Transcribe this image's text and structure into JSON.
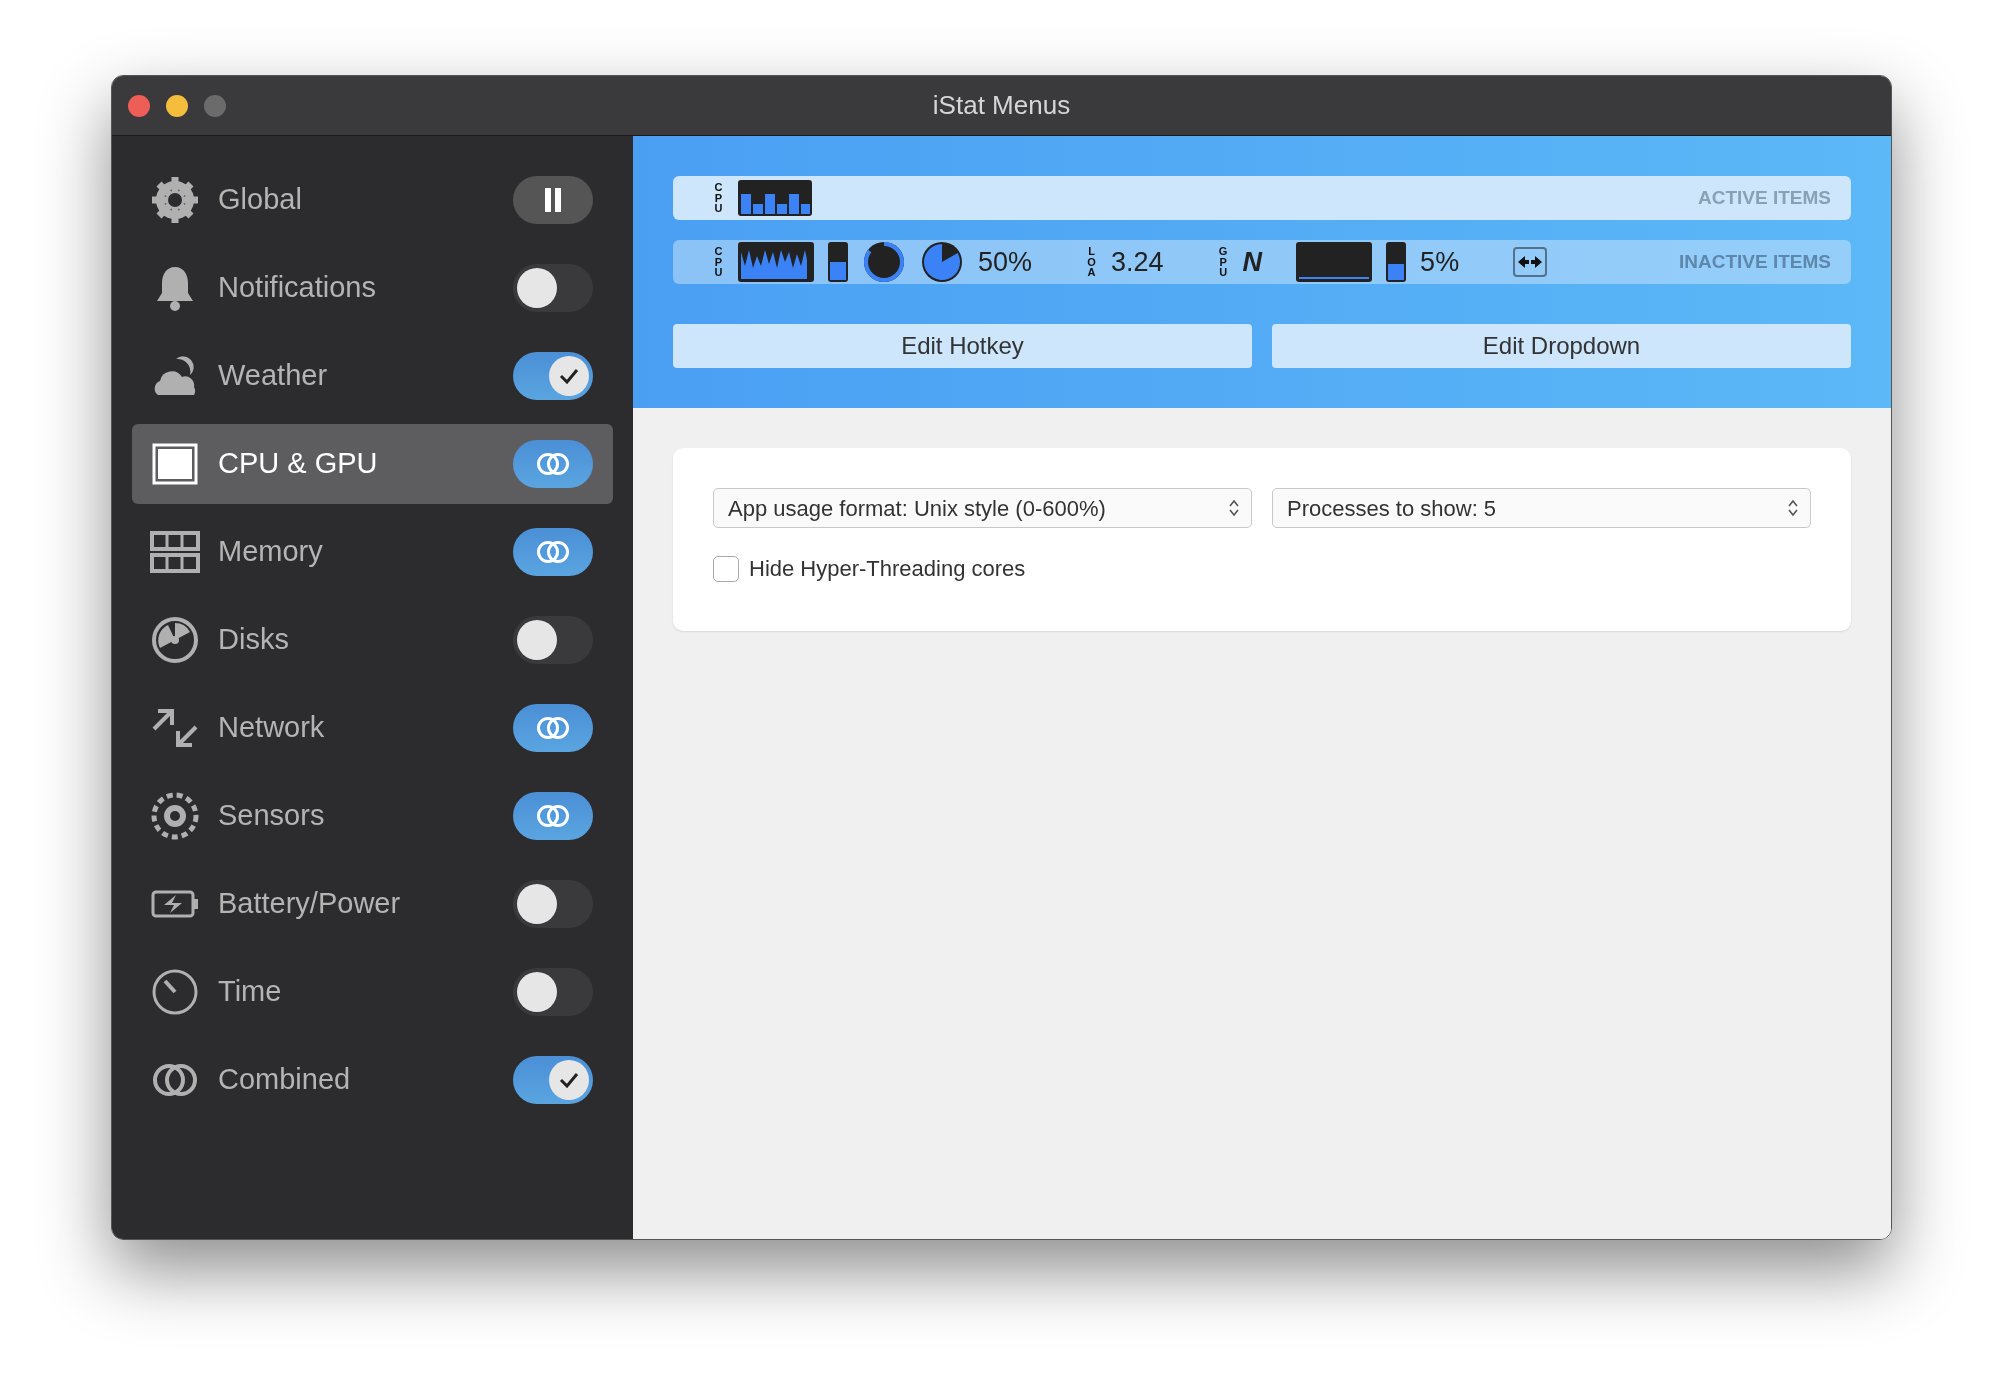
{
  "window": {
    "title": "iStat Menus"
  },
  "sidebar": {
    "items": [
      {
        "label": "Global",
        "selected": false,
        "kind": "pause"
      },
      {
        "label": "Notifications",
        "selected": false,
        "kind": "switch",
        "on": false
      },
      {
        "label": "Weather",
        "selected": false,
        "kind": "switch",
        "on": true
      },
      {
        "label": "CPU & GPU",
        "selected": true,
        "kind": "combined"
      },
      {
        "label": "Memory",
        "selected": false,
        "kind": "combined"
      },
      {
        "label": "Disks",
        "selected": false,
        "kind": "switch",
        "on": false
      },
      {
        "label": "Network",
        "selected": false,
        "kind": "combined"
      },
      {
        "label": "Sensors",
        "selected": false,
        "kind": "combined"
      },
      {
        "label": "Battery/Power",
        "selected": false,
        "kind": "switch",
        "on": false
      },
      {
        "label": "Time",
        "selected": false,
        "kind": "switch",
        "on": false
      },
      {
        "label": "Combined",
        "selected": false,
        "kind": "switch",
        "on": true
      }
    ]
  },
  "active_items": {
    "heading": "ACTIVE ITEMS",
    "items": [
      {
        "kind": "label",
        "text": "CPU"
      },
      {
        "kind": "bars"
      }
    ]
  },
  "inactive_items": {
    "heading": "INACTIVE ITEMS",
    "items": [
      {
        "kind": "label",
        "text": "CPU"
      },
      {
        "kind": "history"
      },
      {
        "kind": "meter",
        "level": 0.5
      },
      {
        "kind": "ring"
      },
      {
        "kind": "pie"
      },
      {
        "kind": "value",
        "text": "50%"
      },
      {
        "kind": "label",
        "text": "LOA"
      },
      {
        "kind": "value",
        "text": "3.24"
      },
      {
        "kind": "label",
        "text": "GPU"
      },
      {
        "kind": "vendor",
        "text": "N"
      },
      {
        "kind": "empty-graph"
      },
      {
        "kind": "meter",
        "level": 0.45
      },
      {
        "kind": "value",
        "text": "5%"
      },
      {
        "kind": "arrows"
      }
    ]
  },
  "buttons": [
    "Edit Hotkey",
    "Edit Dropdown"
  ],
  "settings": {
    "selects": [
      {
        "value": "App usage format: Unix style (0-600%)"
      },
      {
        "value": "Processes to show: 5"
      }
    ],
    "checkbox": {
      "label": "Hide Hyper-Threading cores",
      "checked": false
    }
  }
}
